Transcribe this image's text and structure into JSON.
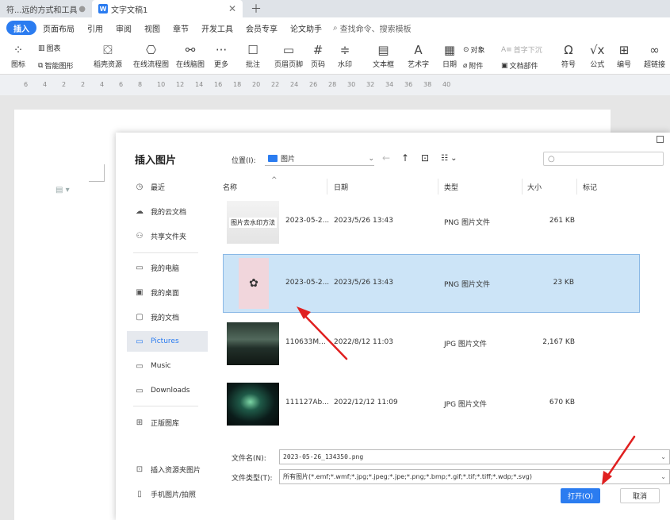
{
  "tabs": [
    {
      "label": "符...远的方式和工具"
    },
    {
      "label": "文字文稿1"
    }
  ],
  "tab_logo": "W",
  "menu": [
    "插入",
    "页面布局",
    "引用",
    "审阅",
    "视图",
    "章节",
    "开发工具",
    "会员专享",
    "论文助手"
  ],
  "menu_search": "查找命令、搜索模板",
  "ribbon": {
    "icon_label": "图标",
    "chart_label": "图表",
    "smart_label": "智能图形",
    "draft_label": "稻壳资源",
    "flow_label": "在线流程图",
    "mind_label": "在线脑图",
    "more_label": "更多",
    "comment_label": "批注",
    "header_label": "页眉页脚",
    "pagenum_label": "页码",
    "watermark_label": "水印",
    "textbox_label": "文本框",
    "wordart_label": "艺术字",
    "date_label": "日期",
    "object_label": "对象",
    "dropcap_label": "首字下沉",
    "attach_label": "附件",
    "docpart_label": "文档部件",
    "symbol_label": "符号",
    "formula_label": "公式",
    "number_label": "编号",
    "hyperlink_label": "超链接"
  },
  "ruler_numbers": [
    "6",
    "4",
    "2",
    "2",
    "4",
    "6",
    "8",
    "10",
    "12",
    "14",
    "16",
    "18",
    "20",
    "22",
    "24",
    "26",
    "28",
    "30",
    "32",
    "34",
    "36",
    "38",
    "40"
  ],
  "dialog": {
    "title": "插入图片",
    "location_label": "位置(I):",
    "location_value": "图片",
    "search_placeholder": "",
    "sidebar": [
      {
        "label": "最近",
        "icon": "clock-icon"
      },
      {
        "label": "我的云文档",
        "icon": "cloud-icon"
      },
      {
        "label": "共享文件夹",
        "icon": "share-icon"
      },
      {
        "label": "我的电脑",
        "icon": "computer-icon"
      },
      {
        "label": "我的桌面",
        "icon": "desktop-icon"
      },
      {
        "label": "我的文档",
        "icon": "document-icon"
      },
      {
        "label": "Pictures",
        "icon": "folder-icon"
      },
      {
        "label": "Music",
        "icon": "folder-icon"
      },
      {
        "label": "Downloads",
        "icon": "folder-icon"
      },
      {
        "label": "正版图库",
        "icon": "gallery-icon"
      },
      {
        "label": "插入资源夹图片",
        "icon": "resource-icon"
      },
      {
        "label": "手机图片/拍照",
        "icon": "phone-icon"
      }
    ],
    "columns": {
      "name": "名称",
      "date": "日期",
      "type": "类型",
      "size": "大小",
      "tag": "标记"
    },
    "files": [
      {
        "thumb_text": "图片去水印方法",
        "name": "2023-05-2...",
        "date": "2023/5/26 13:43",
        "type": "PNG 图片文件",
        "size": "261 KB"
      },
      {
        "thumb_text": "",
        "name": "2023-05-2...",
        "date": "2023/5/26 13:43",
        "type": "PNG 图片文件",
        "size": "23 KB"
      },
      {
        "thumb_text": "",
        "name": "110633M...",
        "date": "2022/8/12 11:03",
        "type": "JPG 图片文件",
        "size": "2,167 KB"
      },
      {
        "thumb_text": "",
        "name": "111127Ab...",
        "date": "2022/12/12 11:09",
        "type": "JPG 图片文件",
        "size": "670 KB"
      }
    ],
    "filename_label": "文件名(N):",
    "filename_value": "2023-05-26_134350.png",
    "filetype_label": "文件类型(T):",
    "filetype_value": "所有图片(*.emf;*.wmf;*.jpg;*.jpeg;*.jpe;*.png;*.bmp;*.gif;*.tif;*.tiff;*.wdp;*.svg)",
    "open_label": "打开(O)",
    "cancel_label": "取消"
  },
  "colors": {
    "accent": "#2b7cf0",
    "selection": "#cce4f7",
    "annotation": "#e02020"
  }
}
